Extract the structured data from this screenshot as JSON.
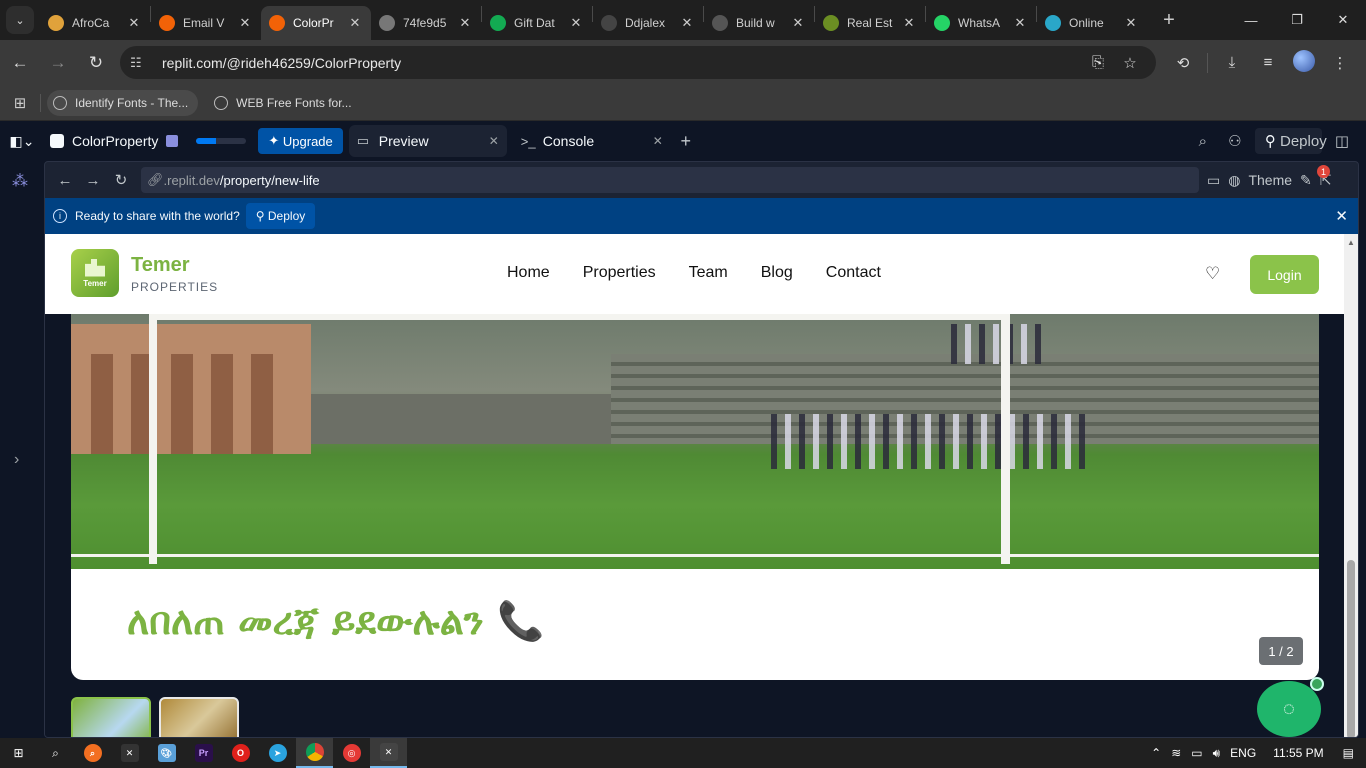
{
  "browser": {
    "tabs": [
      {
        "label": "AfroCa",
        "favicon_color": "#e0a23b"
      },
      {
        "label": "Email V",
        "favicon_color": "#f26207"
      },
      {
        "label": "ColorPr",
        "favicon_color": "#f26207",
        "active": true
      },
      {
        "label": "74fe9d5",
        "favicon_color": "#777777"
      },
      {
        "label": "Gift Dat",
        "favicon_color": "#13aa52"
      },
      {
        "label": "Ddjalex",
        "favicon_color": "#444444"
      },
      {
        "label": "Build w",
        "favicon_color": "#555555"
      },
      {
        "label": "Real Est",
        "favicon_color": "#6b8e23"
      },
      {
        "label": "WhatsA",
        "favicon_color": "#25d366"
      },
      {
        "label": "Online",
        "favicon_color": "#2aa7c9"
      }
    ],
    "url": "replit.com/@rideh46259/ColorProperty",
    "bookmarks": [
      "Identify Fonts - The...",
      "WEB Free Fonts for..."
    ]
  },
  "replit": {
    "repl_name": "ColorProperty",
    "upgrade_label": "Upgrade",
    "tabs": [
      {
        "label": "Preview",
        "icon": "monitor-icon"
      },
      {
        "label": "Console",
        "icon": "terminal-icon"
      }
    ],
    "deploy_label": "Deploy",
    "preview_url_prefix": ".replit.dev",
    "preview_url_path": "/property/new-life",
    "theme_label": "Theme",
    "notification_count": "1",
    "banner_text": "Ready to share with the world?",
    "banner_deploy": "Deploy"
  },
  "site": {
    "brand_name": "Temer",
    "brand_sub": "PROPERTIES",
    "logo_text": "Temer",
    "nav": [
      "Home",
      "Properties",
      "Team",
      "Blog",
      "Contact"
    ],
    "login_label": "Login",
    "headline": "ለበለጠ መረጃ ይደውሉልን 📞",
    "slide_counter": "1 / 2",
    "accent_color": "#8bc34a"
  },
  "taskbar": {
    "language": "ENG",
    "time": "11:55 PM"
  }
}
